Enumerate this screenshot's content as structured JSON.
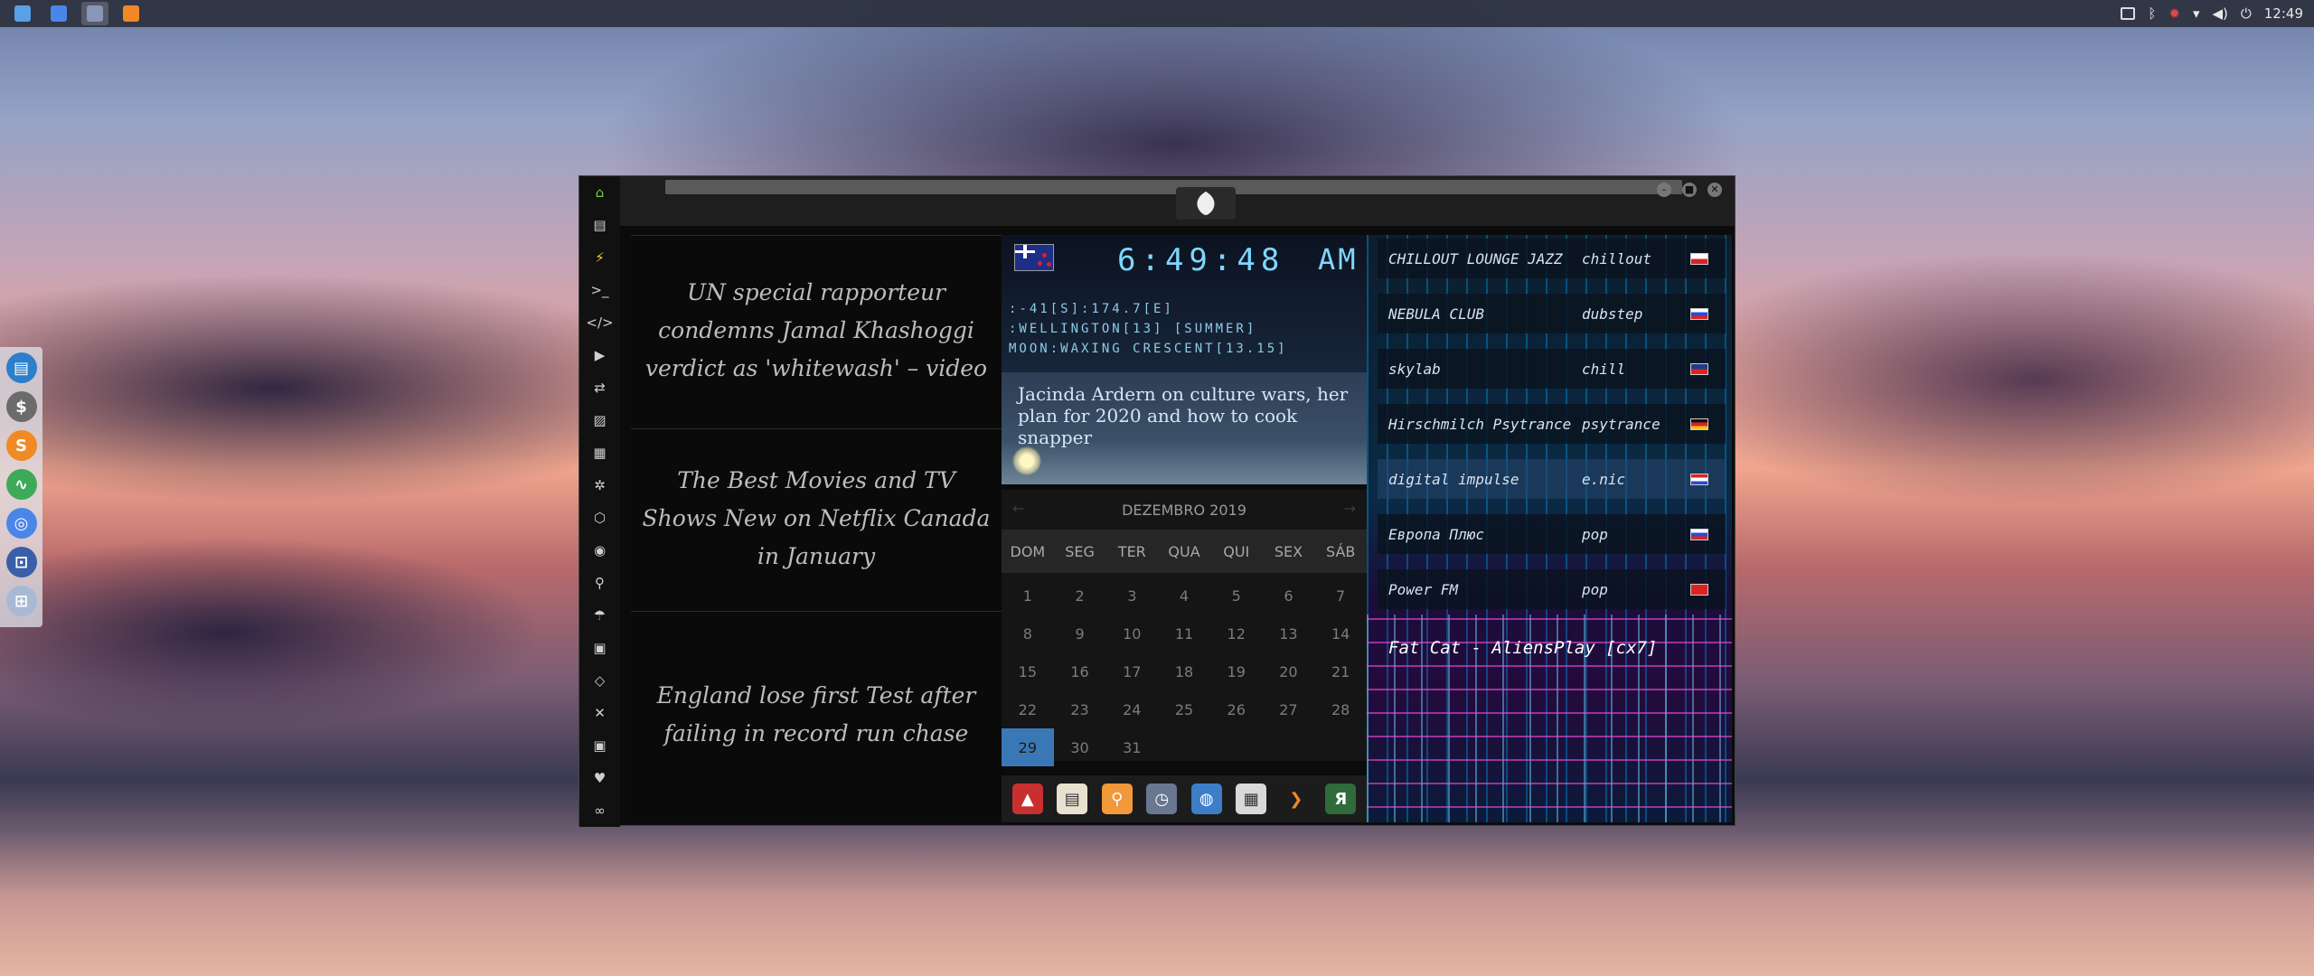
{
  "taskbar": {
    "apps": [
      {
        "icon": "files-icon",
        "color": "#5aa0e6"
      },
      {
        "icon": "chrome-icon",
        "color": "#4a86e8"
      },
      {
        "icon": "window-icon",
        "color": "#8a96b8"
      },
      {
        "icon": "sublime-icon",
        "color": "#f0882a"
      }
    ],
    "clock": "12:49"
  },
  "dock": {
    "items": [
      {
        "icon": "files-icon",
        "color": "#2d7ecb",
        "glyph": "▤"
      },
      {
        "icon": "money-icon",
        "color": "#6b6b6b",
        "glyph": "$"
      },
      {
        "icon": "sublime-s-icon",
        "color": "#f08a24",
        "glyph": "S"
      },
      {
        "icon": "pulse-icon",
        "color": "#3daa5a",
        "glyph": "∿"
      },
      {
        "icon": "chrome-icon",
        "color": "#4a86e8",
        "glyph": "◎"
      },
      {
        "icon": "screenshot-icon",
        "color": "#3a5fa8",
        "glyph": "⊡"
      },
      {
        "icon": "globe-grid-icon",
        "color": "#a9b8d4",
        "glyph": "⊞"
      }
    ]
  },
  "sidebar": {
    "items": [
      {
        "icon": "home-icon",
        "glyph": "⌂",
        "color": "#6fd34a"
      },
      {
        "icon": "document-icon",
        "glyph": "▤",
        "color": "#cfcfcf"
      },
      {
        "icon": "lightning-icon",
        "glyph": "⚡",
        "color": "#f2d23a"
      },
      {
        "icon": "terminal-icon",
        "glyph": ">_",
        "color": "#cfcfcf"
      },
      {
        "icon": "code-icon",
        "glyph": "</>",
        "color": "#cfcfcf"
      },
      {
        "icon": "play-icon",
        "glyph": "▶",
        "color": "#cfcfcf"
      },
      {
        "icon": "translate-icon",
        "glyph": "⇄",
        "color": "#cfcfcf"
      },
      {
        "icon": "image-icon",
        "glyph": "▨",
        "color": "#cfcfcf"
      },
      {
        "icon": "news-icon",
        "glyph": "▦",
        "color": "#cfcfcf"
      },
      {
        "icon": "aperture-icon",
        "glyph": "✲",
        "color": "#cfcfcf"
      },
      {
        "icon": "hexagon-icon",
        "glyph": "⬡",
        "color": "#cfcfcf"
      },
      {
        "icon": "globe-icon",
        "glyph": "◉",
        "color": "#cfcfcf"
      },
      {
        "icon": "search-icon",
        "glyph": "⚲",
        "color": "#cfcfcf"
      },
      {
        "icon": "umbrella-icon",
        "glyph": "☂",
        "color": "#cfcfcf"
      },
      {
        "icon": "contact-icon",
        "glyph": "▣",
        "color": "#cfcfcf"
      },
      {
        "icon": "exchange-icon",
        "glyph": "◇",
        "color": "#cfcfcf"
      },
      {
        "icon": "expand-icon",
        "glyph": "✕",
        "color": "#cfcfcf"
      },
      {
        "icon": "youtube-icon",
        "glyph": "▣",
        "color": "#cfcfcf"
      },
      {
        "icon": "heart-icon",
        "glyph": "♥",
        "color": "#cfcfcf"
      },
      {
        "icon": "link-icon",
        "glyph": "∞",
        "color": "#cfcfcf"
      }
    ]
  },
  "window": {
    "emblem_icon": "rebel-alliance-icon"
  },
  "news": [
    {
      "title": "UN special rapporteur condemns Jamal Khashoggi verdict as 'whitewash' – video"
    },
    {
      "title": "The Best Movies and TV Shows New on Netflix Canada in January"
    },
    {
      "title": "England lose first Test after failing in record run chase"
    }
  ],
  "world_clock": {
    "flag_icon": "new-zealand-flag-icon",
    "time": "6:49:48",
    "ampm": "AM",
    "coords": ":-41[S]:174.7[E]",
    "location": ":WELLINGTON[13] [SUMMER]",
    "moon": "MOON:WAXING CRESCENT[13.15]"
  },
  "headline": {
    "text": "Jacinda Ardern on culture wars, her plan for 2020 and how to cook snapper"
  },
  "calendar": {
    "month": "DEZEMBRO 2019",
    "weekdays": [
      "DOM",
      "SEG",
      "TER",
      "QUA",
      "QUI",
      "SEX",
      "SÁB"
    ],
    "days": [
      "1",
      "2",
      "3",
      "4",
      "5",
      "6",
      "7",
      "8",
      "9",
      "10",
      "11",
      "12",
      "13",
      "14",
      "15",
      "16",
      "17",
      "18",
      "19",
      "20",
      "21",
      "22",
      "23",
      "24",
      "25",
      "26",
      "27",
      "28",
      "29",
      "30",
      "31"
    ],
    "today": "29"
  },
  "launcher": [
    {
      "icon": "red-app-icon",
      "color": "#c8302f",
      "glyph": "▲"
    },
    {
      "icon": "notes-icon",
      "color": "#e9e1d0",
      "glyph": "▤"
    },
    {
      "icon": "search-app-icon",
      "color": "#f0983a",
      "glyph": "⚲"
    },
    {
      "icon": "clock-app-icon",
      "color": "#6a7790",
      "glyph": "◷"
    },
    {
      "icon": "globe-app-icon",
      "color": "#3d7ec8",
      "glyph": "◍"
    },
    {
      "icon": "calendar-app-icon",
      "color": "#d9d9d9",
      "glyph": "▦"
    },
    {
      "icon": "arrow-app-icon",
      "color": "#1c1c1c",
      "glyph": "❯"
    },
    {
      "icon": "yandex-app-icon",
      "color": "#2f6b3b",
      "glyph": "Я"
    }
  ],
  "radio": {
    "stations": [
      {
        "name": "CHILLOUT LOUNGE JAZZ",
        "genre": "chillout",
        "flag_colors": [
          "#ffffff",
          "#d22"
        ]
      },
      {
        "name": "NEBULA CLUB",
        "genre": "dubstep",
        "flag_colors": [
          "#ffffff",
          "#2a4bd8",
          "#d22"
        ]
      },
      {
        "name": "skylab",
        "genre": "chill",
        "flag_colors": [
          "#1e3a8a",
          "#d22"
        ]
      },
      {
        "name": "Hirschmilch Psytrance",
        "genre": "psytrance",
        "flag_colors": [
          "#111111",
          "#d22",
          "#f2c51a"
        ]
      },
      {
        "name": "digital impulse",
        "genre": "e.nic",
        "flag_colors": [
          "#d22",
          "#ffffff",
          "#2a4bd8"
        ]
      },
      {
        "name": "Европа Плюс",
        "genre": "pop",
        "flag_colors": [
          "#ffffff",
          "#2a4bd8",
          "#d22"
        ]
      },
      {
        "name": "Power FM",
        "genre": "pop",
        "flag_colors": [
          "#d22",
          "#d22"
        ]
      }
    ],
    "active_index": 4,
    "now_playing": "Fat Cat - AliensPlay [cx7]"
  }
}
